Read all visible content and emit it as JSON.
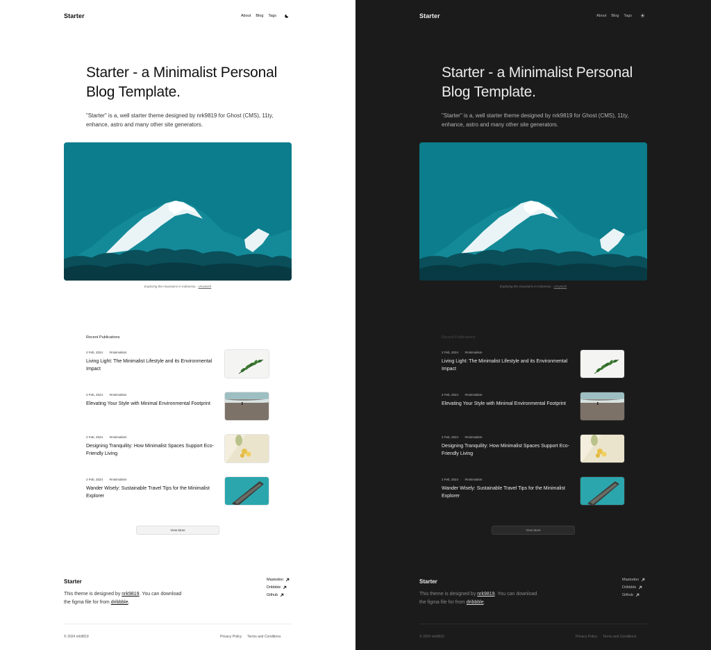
{
  "site": {
    "brand": "Starter",
    "nav": [
      "About",
      "Blog",
      "Tags"
    ]
  },
  "hero": {
    "title": "Starter - a Minimalist Personal Blog Template.",
    "description": "\"Starter\" is a, well starter theme designed by nrk9819 for Ghost (CMS), 11ty, enhance, astro and many other site generators.",
    "caption_text": "Exploring the mountains in Indonesia - ",
    "caption_link": "Unsplash"
  },
  "publications": {
    "heading": "Recent Publications",
    "items": [
      {
        "date": "2 Feb, 2024",
        "tag": "#minimalism",
        "title": "Living Light: The Minimalist Lifestyle and its Environmental Impact",
        "thumb": "leaf"
      },
      {
        "date": "2 Feb, 2024",
        "tag": "#minimalism",
        "title": "Elevating Your Style with Minimal Environmental Footprint",
        "thumb": "beach"
      },
      {
        "date": "2 Feb, 2024",
        "tag": "#minimalism",
        "title": "Designing Tranquility: How Minimalist Spaces Support Eco-Friendly Living",
        "thumb": "flower"
      },
      {
        "date": "2 Feb, 2024",
        "tag": "#minimalism",
        "title": "Wander Wisely: Sustainable Travel Tips for the Minimalist Explorer",
        "thumb": "boat"
      }
    ],
    "view_more": "View More"
  },
  "footer": {
    "brand": "Starter",
    "desc_prefix": "This theme is designed by ",
    "author_link": "nrk9819",
    "desc_middle": ". You can download the figma file for from ",
    "dribbble_link": "dribbble",
    "desc_suffix": ".",
    "social": [
      "Mastodon",
      "Dribbble",
      "Github"
    ],
    "copyright": "© 2024 nrk9819",
    "legal": [
      "Privacy Policy",
      "Terms and Conditions"
    ]
  },
  "colors": {
    "hero_teal": "#0b7f8f",
    "dark_bg": "#1b1b1b",
    "light_bg": "#ffffff"
  },
  "icons": {
    "light_theme_toggle": "moon-icon",
    "dark_theme_toggle": "sun-icon",
    "social_arrow": "arrow-up-right-icon"
  }
}
